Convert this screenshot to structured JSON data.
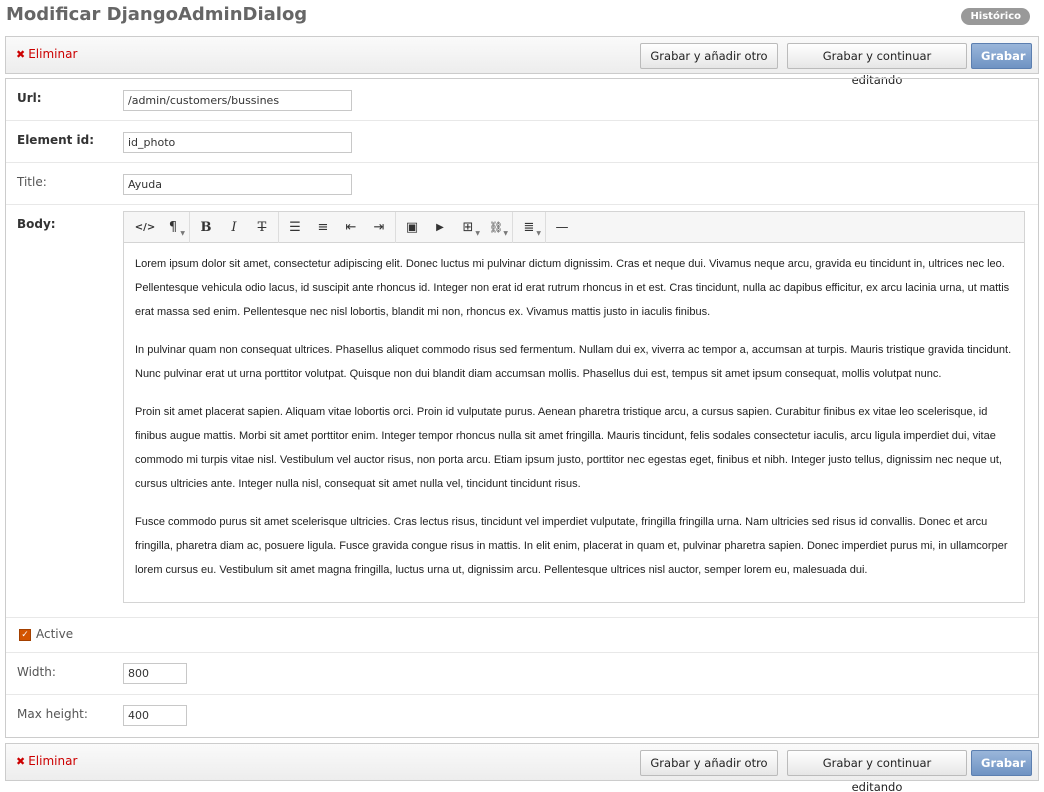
{
  "page": {
    "title": "Modificar DjangoAdminDialog",
    "history_label": "Histórico"
  },
  "actions": {
    "delete_label": "Eliminar",
    "save_add_another_label": "Grabar y añadir otro",
    "save_continue_label": "Grabar y continuar editando",
    "save_label": "Grabar"
  },
  "form": {
    "url": {
      "label": "Url:",
      "value": "/admin/customers/bussines"
    },
    "element_id": {
      "label": "Element id:",
      "value": "id_photo"
    },
    "title": {
      "label": "Title:",
      "value": "Ayuda"
    },
    "body": {
      "label": "Body:",
      "toolbar": {
        "html": "</>",
        "format": "¶",
        "bold": "B",
        "italic": "I",
        "deleted": "T",
        "unordered_list": "☰",
        "ordered_list": "≡",
        "outdent": "⇤",
        "indent": "⇥",
        "image": "▣",
        "video": "▶",
        "table": "⊞",
        "link": "⛓",
        "alignment": "≣",
        "horizontal_rule": "—"
      },
      "paragraphs": [
        "Lorem ipsum dolor sit amet, consectetur adipiscing elit. Donec luctus mi pulvinar dictum dignissim. Cras et neque dui. Vivamus neque arcu, gravida eu tincidunt in, ultrices nec leo. Pellentesque vehicula odio lacus, id suscipit ante rhoncus id. Integer non erat id erat rutrum rhoncus in et est. Cras tincidunt, nulla ac dapibus efficitur, ex arcu lacinia urna, ut mattis erat massa sed enim. Pellentesque nec nisl lobortis, blandit mi non, rhoncus ex. Vivamus mattis justo in iaculis finibus.",
        "In pulvinar quam non consequat ultrices. Phasellus aliquet commodo risus sed fermentum. Nullam dui ex, viverra ac tempor a, accumsan at turpis. Mauris tristique gravida tincidunt. Nunc pulvinar erat ut urna porttitor volutpat. Quisque non dui blandit diam accumsan mollis. Phasellus dui est, tempus sit amet ipsum consequat, mollis volutpat nunc.",
        "Proin sit amet placerat sapien. Aliquam vitae lobortis orci. Proin id vulputate purus. Aenean pharetra tristique arcu, a cursus sapien. Curabitur finibus ex vitae leo scelerisque, id finibus augue mattis. Morbi sit amet porttitor enim. Integer tempor rhoncus nulla sit amet fringilla. Mauris tincidunt, felis sodales consectetur iaculis, arcu ligula imperdiet dui, vitae commodo mi turpis vitae nisl. Vestibulum vel auctor risus, non porta arcu. Etiam ipsum justo, porttitor nec egestas eget, finibus et nibh. Integer justo tellus, dignissim nec neque ut, cursus ultricies ante. Integer nulla nisl, consequat sit amet nulla vel, tincidunt tincidunt risus.",
        "Fusce commodo purus sit amet scelerisque ultricies. Cras lectus risus, tincidunt vel imperdiet vulputate, fringilla fringilla urna. Nam ultricies sed risus id convallis. Donec et arcu fringilla, pharetra diam ac, posuere ligula. Fusce gravida congue risus in mattis. In elit enim, placerat in quam et, pulvinar pharetra sapien. Donec imperdiet purus mi, in ullamcorper lorem cursus eu. Vestibulum sit amet magna fringilla, luctus urna ut, dignissim arcu. Pellentesque ultrices nisl auctor, semper lorem eu, malesuada dui."
      ]
    },
    "active": {
      "label": "Active",
      "checked": true
    },
    "width": {
      "label": "Width:",
      "value": "800"
    },
    "max_height": {
      "label": "Max height:",
      "value": "400"
    }
  },
  "colors": {
    "delete": "#cc0000",
    "save_button": "#6f93c3",
    "checkbox": "#d35400"
  }
}
